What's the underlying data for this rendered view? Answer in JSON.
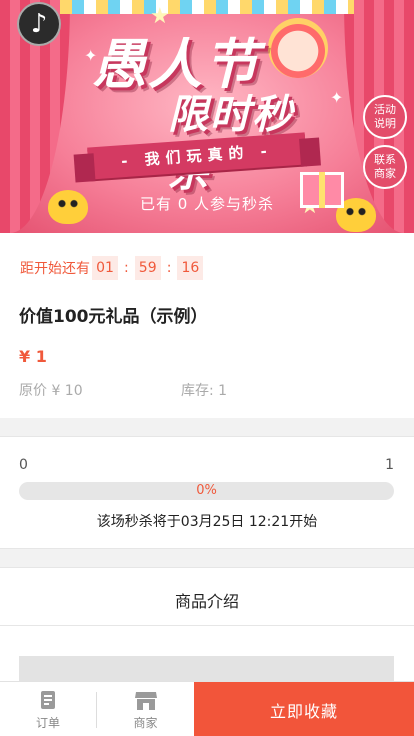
{
  "banner": {
    "title_line1": "愚人节",
    "title_line2": "限时秒杀",
    "ribbon": "- 我们玩真的 -",
    "participants": "已有 0 人参与秒杀",
    "side_buttons": [
      {
        "line1": "活动",
        "line2": "说明"
      },
      {
        "line1": "联系",
        "line2": "商家"
      }
    ],
    "music_icon": "music-note-icon"
  },
  "countdown": {
    "label": "距开始还有",
    "hours": "01",
    "minutes": "59",
    "seconds": "16",
    "separator": ":"
  },
  "product": {
    "title": "价值100元礼品（示例）",
    "price": "¥ 1",
    "original_price": "原价 ¥ 10",
    "stock": "库存: 1"
  },
  "progress": {
    "min": "0",
    "max": "1",
    "percent_label": "0%",
    "fraction": 0,
    "note": "该场秒杀将于03月25日 12:21开始"
  },
  "intro": {
    "title": "商品介绍"
  },
  "bottom_bar": {
    "orders_label": "订单",
    "merchant_label": "商家",
    "collect_label": "立即收藏"
  },
  "colors": {
    "accent": "#f2553a",
    "banner_pink": "#f67f98"
  }
}
